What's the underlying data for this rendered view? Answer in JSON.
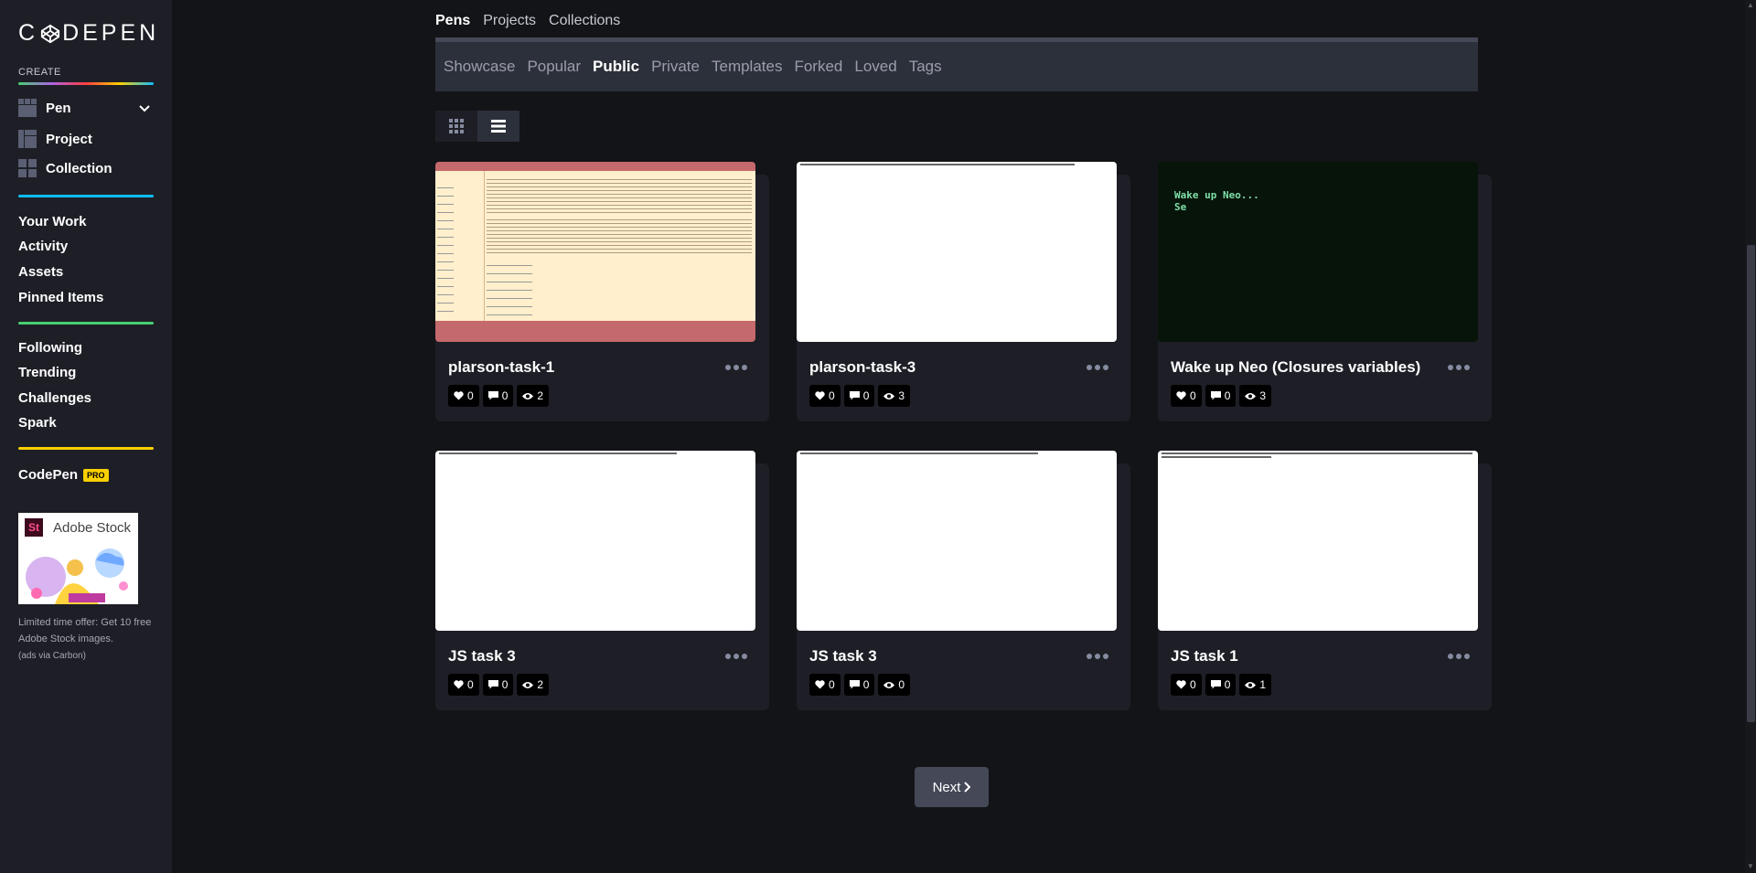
{
  "sidebar": {
    "logo_text": "DEPEN",
    "create_label": "CREATE",
    "create_items": [
      {
        "label": "Pen",
        "icon": "pen-layout-icon"
      },
      {
        "label": "Project",
        "icon": "project-layout-icon"
      },
      {
        "label": "Collection",
        "icon": "collection-grid-icon"
      }
    ],
    "nav_group_1": [
      "Your Work",
      "Activity",
      "Assets",
      "Pinned Items"
    ],
    "nav_group_2": [
      "Following",
      "Trending",
      "Challenges",
      "Spark"
    ],
    "pro": {
      "label": "CodePen",
      "badge": "PRO"
    },
    "ad": {
      "brand_mark": "St",
      "brand_name": "Adobe Stock",
      "text": "Limited time offer: Get 10 free Adobe Stock images.",
      "via": "(ads via Carbon)"
    },
    "colors": {
      "divider_1": "#0ebeff",
      "divider_2": "#47cf73",
      "divider_3": "#fcd000"
    }
  },
  "top_tabs": [
    {
      "label": "Pens",
      "active": true
    },
    {
      "label": "Projects",
      "active": false
    },
    {
      "label": "Collections",
      "active": false
    }
  ],
  "filters": [
    {
      "label": "Showcase",
      "active": false
    },
    {
      "label": "Popular",
      "active": false
    },
    {
      "label": "Public",
      "active": true
    },
    {
      "label": "Private",
      "active": false
    },
    {
      "label": "Templates",
      "active": false
    },
    {
      "label": "Forked",
      "active": false
    },
    {
      "label": "Loved",
      "active": false
    },
    {
      "label": "Tags",
      "active": false
    }
  ],
  "view_toggle": {
    "grid_icon": "grid-icon",
    "list_icon": "list-icon",
    "active": "list"
  },
  "pens": [
    {
      "title": "plarson-task-1",
      "likes": "0",
      "comments": "0",
      "views": "2",
      "preview": "table"
    },
    {
      "title": "plarson-task-3",
      "likes": "0",
      "comments": "0",
      "views": "3",
      "preview": "blank"
    },
    {
      "title": "Wake up Neo (Closures variables)",
      "likes": "0",
      "comments": "0",
      "views": "3",
      "preview": "terminal",
      "preview_text_1": "Wake up Neo...",
      "preview_text_2": "Se"
    },
    {
      "title": "JS task 3",
      "likes": "0",
      "comments": "0",
      "views": "2",
      "preview": "blank"
    },
    {
      "title": "JS task 3",
      "likes": "0",
      "comments": "0",
      "views": "0",
      "preview": "blank"
    },
    {
      "title": "JS task 1",
      "likes": "0",
      "comments": "0",
      "views": "1",
      "preview": "blank"
    }
  ],
  "pagination": {
    "next_label": "Next"
  }
}
